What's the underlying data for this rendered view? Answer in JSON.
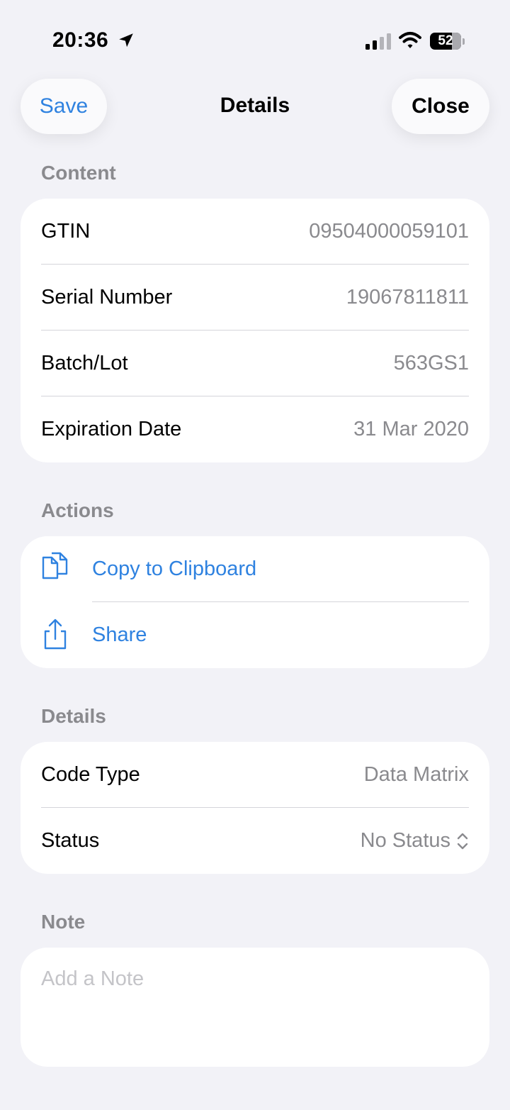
{
  "status_bar": {
    "time": "20:36",
    "battery": "52",
    "icons": [
      "location-arrow-icon",
      "cellular-signal-icon",
      "wifi-icon",
      "battery-icon"
    ]
  },
  "nav": {
    "title": "Details",
    "save_label": "Save",
    "close_label": "Close"
  },
  "content": {
    "header": "Content",
    "rows": [
      {
        "label": "GTIN",
        "value": "09504000059101"
      },
      {
        "label": "Serial Number",
        "value": "19067811811"
      },
      {
        "label": "Batch/Lot",
        "value": "563GS1"
      },
      {
        "label": "Expiration Date",
        "value": "31 Mar 2020"
      }
    ]
  },
  "actions": {
    "header": "Actions",
    "items": [
      {
        "label": "Copy to Clipboard",
        "icon": "copy-documents-icon"
      },
      {
        "label": "Share",
        "icon": "share-icon"
      }
    ]
  },
  "details": {
    "header": "Details",
    "code_type_label": "Code Type",
    "code_type_value": "Data Matrix",
    "status_label": "Status",
    "status_value": "No Status",
    "status_icon": "chevron-up-down-icon"
  },
  "note": {
    "header": "Note",
    "placeholder": "Add a Note"
  },
  "colors": {
    "background": "#f2f2f7",
    "accent": "#2f82e0",
    "secondary_text": "#8a8a8e",
    "placeholder": "#c4c4c8"
  }
}
